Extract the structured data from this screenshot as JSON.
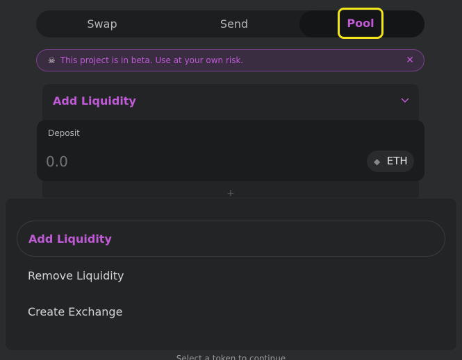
{
  "tabs": [
    {
      "label": "Swap"
    },
    {
      "label": "Send"
    },
    {
      "label": "Pool"
    }
  ],
  "banner": {
    "icon": "skull-icon",
    "text": "This project is in beta. Use at your own risk.",
    "close": "✕"
  },
  "card": {
    "title": "Add Liquidity"
  },
  "deposit": {
    "label": "Deposit",
    "placeholder": "0.0",
    "token": "ETH"
  },
  "plus": "+",
  "dropdown": {
    "options": [
      {
        "label": "Add Liquidity",
        "selected": true
      },
      {
        "label": "Remove Liquidity"
      },
      {
        "label": "Create Exchange"
      }
    ]
  },
  "footer": {
    "hint": "Select a token to continue"
  },
  "colors": {
    "accent": "#c05ad6",
    "highlight": "#f2e51c"
  }
}
